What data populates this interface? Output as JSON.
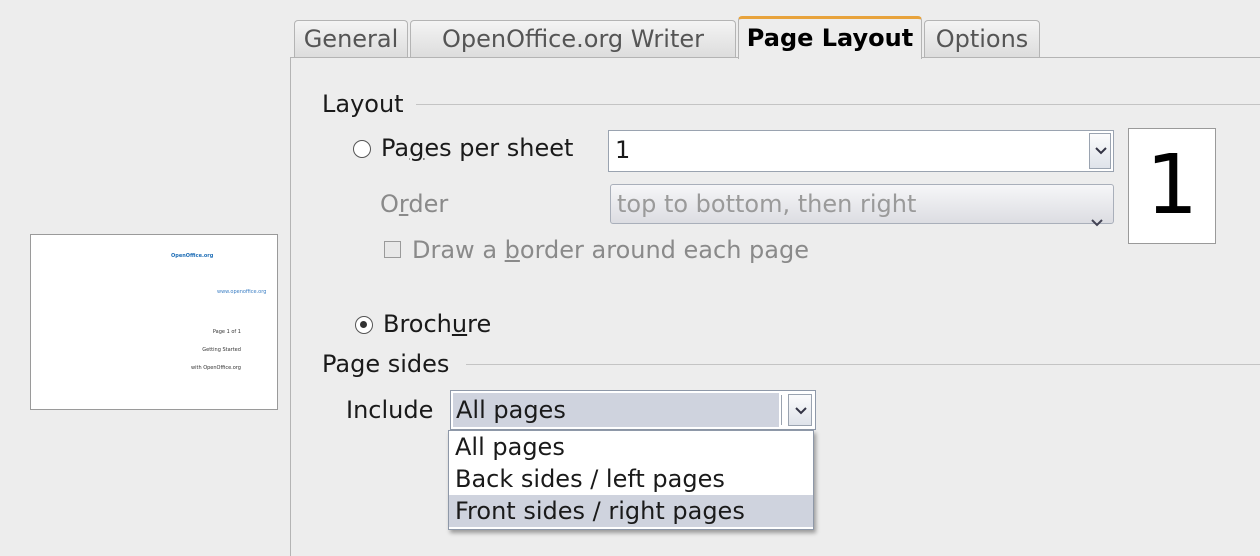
{
  "tabs": [
    "General",
    "OpenOffice.org Writer",
    "Page Layout",
    "Options"
  ],
  "active_tab": "Page Layout",
  "preview": {
    "title": "OpenOffice.org",
    "link": "www.openoffice.org",
    "body_lines": [
      "Page 1 of 1",
      "Getting Started",
      "with OpenOffice.org"
    ]
  },
  "layout": {
    "section_label": "Layout",
    "pages_per_sheet": {
      "label_pre": "Pa",
      "label_access": "g",
      "label_post": "es per sheet",
      "value": "1",
      "selected": false
    },
    "order": {
      "label_pre": "O",
      "label_access": "r",
      "label_post": "der",
      "value": "top to bottom, then right",
      "enabled": false
    },
    "draw_border": {
      "label_pre": "Draw a ",
      "label_access": "b",
      "label_post": "order around each page",
      "checked": false,
      "enabled": false
    },
    "brochure": {
      "label_pre": "Broch",
      "label_access": "u",
      "label_post": "re",
      "selected": true
    },
    "preview_number": "1"
  },
  "page_sides": {
    "section_label": "Page sides",
    "include_label": "Include",
    "value": "All pages",
    "options": [
      "All pages",
      "Back sides / left pages",
      "Front sides / right pages"
    ],
    "highlighted_option": "Front sides / right pages"
  }
}
